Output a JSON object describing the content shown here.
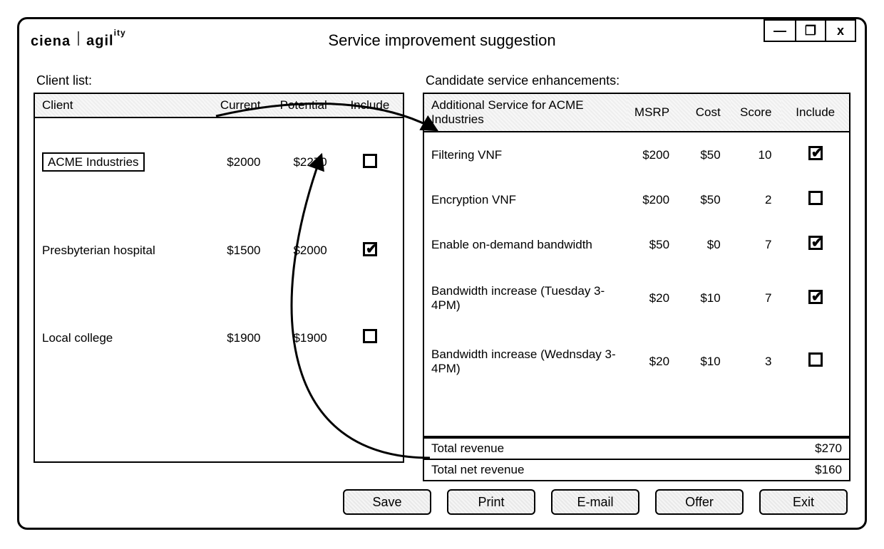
{
  "brand": {
    "ciena": "ciena",
    "agility_prefix": "agil",
    "agility_sup": "ity"
  },
  "window": {
    "title": "Service improvement suggestion",
    "min": "—",
    "max": "❐",
    "close": "x"
  },
  "left": {
    "label": "Client list:",
    "headers": {
      "client": "Client",
      "current": "Current",
      "potential": "Potential",
      "include": "Include"
    },
    "rows": [
      {
        "client": "ACME Industries",
        "current": "$2000",
        "potential": "$2270",
        "include": false,
        "selected": true
      },
      {
        "client": "Presbyterian hospital",
        "current": "$1500",
        "potential": "$2000",
        "include": true,
        "selected": false
      },
      {
        "client": "Local college",
        "current": "$1900",
        "potential": "$1900",
        "include": false,
        "selected": false
      }
    ]
  },
  "right": {
    "label": "Candidate service enhancements:",
    "headers": {
      "service": "Additional Service for ACME Industries",
      "msrp": "MSRP",
      "cost": "Cost",
      "score": "Score",
      "include": "Include"
    },
    "rows": [
      {
        "service": "Filtering VNF",
        "msrp": "$200",
        "cost": "$50",
        "score": "10",
        "include": true
      },
      {
        "service": "Encryption VNF",
        "msrp": "$200",
        "cost": "$50",
        "score": "2",
        "include": false
      },
      {
        "service": "Enable on-demand bandwidth",
        "msrp": "$50",
        "cost": "$0",
        "score": "7",
        "include": true
      },
      {
        "service": "Bandwidth increase (Tuesday 3-4PM)",
        "msrp": "$20",
        "cost": "$10",
        "score": "7",
        "include": true
      },
      {
        "service": "Bandwidth increase (Wednsday 3-4PM)",
        "msrp": "$20",
        "cost": "$10",
        "score": "3",
        "include": false
      }
    ],
    "totals": {
      "revenue_label": "Total revenue",
      "revenue_value": "$270",
      "net_label": "Total net revenue",
      "net_value": "$160"
    }
  },
  "footer": {
    "save": "Save",
    "print": "Print",
    "email": "E-mail",
    "offer": "Offer",
    "exit": "Exit"
  }
}
